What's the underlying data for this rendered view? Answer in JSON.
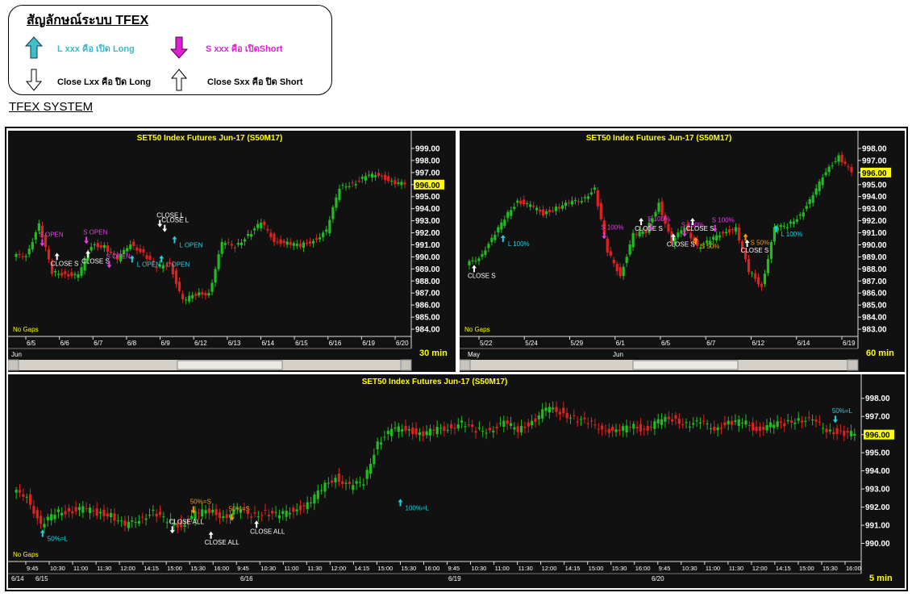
{
  "legend": {
    "title": "สัญลักษณ์ระบบ TFEX",
    "open_long": {
      "label": "L xxx คือ เปิด Long",
      "color": "#3fb7c4"
    },
    "open_short": {
      "label": "S xxx คือ เปิดShort",
      "color": "#e020d0"
    },
    "close_long": {
      "label": "Close Lxx คือ ปิด Long"
    },
    "close_short": {
      "label": "Close Sxx คือ ปิด Short"
    }
  },
  "system_title": "TFEX SYSTEM",
  "colors": {
    "background": "#111111",
    "up": "#22bb22",
    "down": "#dd2222",
    "title": "#ffff00",
    "axis_text": "#ffffff",
    "long": "#22d0e0",
    "short": "#e040e0",
    "close": "#ffffff",
    "half": "#ff9900",
    "price_box": "#ffff00"
  },
  "chart_data": [
    {
      "type": "line",
      "title": "SET50  Index  Futures  Jun-17  (S50M17)",
      "timeframe": "30  min",
      "no_gaps": "No Gaps",
      "yticks": [
        "999.00",
        "998.00",
        "997.00",
        "996.00",
        "995.00",
        "994.00",
        "993.00",
        "992.00",
        "991.00",
        "990.00",
        "989.00",
        "988.00",
        "987.00",
        "986.00",
        "985.00",
        "984.00"
      ],
      "ylim": [
        983.4,
        999.4
      ],
      "current_price": "996.00",
      "current_value": 996.0,
      "xticks": [
        "6/5",
        "6/6",
        "6/7",
        "6/8",
        "6/9",
        "6/12",
        "6/13",
        "6/14",
        "6/15",
        "6/16",
        "6/19",
        "6/20"
      ],
      "month_label": "Jun",
      "x": [
        0,
        4,
        8,
        12,
        16,
        20,
        24,
        28,
        32,
        36,
        40,
        44,
        48,
        52,
        56,
        60,
        64,
        68,
        72,
        76,
        80,
        84,
        88,
        92,
        96,
        100,
        104,
        108,
        112,
        116,
        120
      ],
      "series": [
        {
          "values": [
            990.0,
            990.2,
            992.6,
            988.7,
            988.6,
            988.4,
            991.0,
            990.9,
            989.7,
            991.2,
            990.2,
            989.1,
            989.5,
            986.3,
            986.9,
            987.0,
            991.1,
            990.9,
            991.8,
            992.8,
            991.4,
            991.1,
            990.9,
            991.4,
            992.1,
            995.8,
            996.1,
            996.6,
            996.9,
            996.2,
            996.0
          ]
        }
      ],
      "annotations": [
        {
          "text": "S  OPEN",
          "x": 8.5,
          "y": 991.4,
          "kind": "short",
          "dir": "down"
        },
        {
          "text": "CLOSE  S",
          "x": 13,
          "y": 989.8,
          "kind": "close",
          "dir": "up"
        },
        {
          "text": "S  OPEN",
          "x": 22,
          "y": 991.6,
          "kind": "short",
          "dir": "down"
        },
        {
          "text": "CLOSE  S",
          "x": 22.5,
          "y": 990.0,
          "kind": "close",
          "dir": "up"
        },
        {
          "text": "S  OPEN",
          "x": 29,
          "y": 989.6,
          "kind": "short",
          "dir": "down"
        },
        {
          "text": "L  OPEN",
          "x": 36,
          "y": 989.6,
          "kind": "long",
          "dir": "up"
        },
        {
          "text": "L  OPEN",
          "x": 45,
          "y": 989.6,
          "kind": "long",
          "dir": "up"
        },
        {
          "text": "CLOSE  L",
          "x": 44.5,
          "y": 993.0,
          "kind": "close",
          "dir": "down"
        },
        {
          "text": "CLOSE  L",
          "x": 46,
          "y": 992.6,
          "kind": "close",
          "dir": "down"
        },
        {
          "text": "L  OPEN",
          "x": 49,
          "y": 991.2,
          "kind": "long",
          "dir": "up"
        }
      ]
    },
    {
      "type": "line",
      "title": "SET50  Index  Futures  Jun-17  (S50M17)",
      "timeframe": "60  min",
      "no_gaps": "No Gaps",
      "yticks": [
        "998.00",
        "997.00",
        "996.00",
        "995.00",
        "994.00",
        "993.00",
        "992.00",
        "991.00",
        "990.00",
        "989.00",
        "988.00",
        "987.00",
        "986.00",
        "985.00",
        "984.00",
        "983.00"
      ],
      "ylim": [
        982.4,
        998.4
      ],
      "current_price": "996.00",
      "current_value": 996.0,
      "xticks": [
        "5/22",
        "5/24",
        "5/29",
        "6/1",
        "6/5",
        "6/7",
        "6/12",
        "6/14",
        "6/19"
      ],
      "month_label_1": "May",
      "month_label_2": "Jun",
      "x": [
        0,
        4,
        8,
        12,
        16,
        20,
        24,
        28,
        32,
        36,
        40,
        44,
        48,
        52,
        56,
        60,
        64,
        68,
        72,
        76,
        80,
        84,
        88,
        92,
        96,
        100,
        104,
        108,
        112,
        116,
        120
      ],
      "series": [
        {
          "values": [
            988.3,
            989.0,
            990.4,
            992.2,
            993.7,
            993.2,
            992.6,
            993.1,
            993.4,
            993.8,
            994.6,
            989.4,
            987.5,
            990.8,
            991.1,
            993.5,
            990.1,
            991.6,
            989.8,
            990.3,
            991.1,
            991.3,
            987.8,
            986.6,
            991.3,
            991.6,
            992.5,
            994.0,
            996.2,
            997.3,
            996.0
          ]
        }
      ],
      "annotations": [
        {
          "text": "CLOSE  S",
          "x": 2,
          "y": 987.8,
          "kind": "close",
          "dir": "up"
        },
        {
          "text": "L  100%",
          "x": 11,
          "y": 990.3,
          "kind": "long",
          "dir": "up"
        },
        {
          "text": "S  100%",
          "x": 42.5,
          "y": 991.0,
          "kind": "short",
          "dir": "down"
        },
        {
          "text": "CLOSE  S",
          "x": 54,
          "y": 991.7,
          "kind": "close",
          "dir": "up"
        },
        {
          "text": "S  100%",
          "x": 57,
          "y": 991.7,
          "kind": "short",
          "dir": "down"
        },
        {
          "text": "CLOSE  S",
          "x": 64,
          "y": 990.4,
          "kind": "close",
          "dir": "up"
        },
        {
          "text": "S  100%",
          "x": 67.5,
          "y": 991.2,
          "kind": "short",
          "dir": "down"
        },
        {
          "text": "S  100%",
          "x": 77,
          "y": 991.6,
          "kind": "short",
          "dir": "down"
        },
        {
          "text": "CLOSE  S",
          "x": 70,
          "y": 991.7,
          "kind": "close",
          "dir": "up"
        },
        {
          "text": "S  50%",
          "x": 71,
          "y": 990.1,
          "kind": "half",
          "dir": "up"
        },
        {
          "text": "S  50%",
          "x": 86.5,
          "y": 990.4,
          "kind": "half",
          "dir": "up"
        },
        {
          "text": "CLOSE  S",
          "x": 87,
          "y": 989.9,
          "kind": "close",
          "dir": "up"
        },
        {
          "text": "L  100%",
          "x": 96,
          "y": 991.1,
          "kind": "long",
          "dir": "up"
        }
      ]
    },
    {
      "type": "line",
      "title": "SET50  Index  Futures  Jun-17  (S50M17)",
      "timeframe": "5  min",
      "no_gaps": "No Gaps",
      "yticks": [
        "998.00",
        "997.00",
        "996.00",
        "995.00",
        "994.00",
        "993.00",
        "992.00",
        "991.00",
        "990.00"
      ],
      "ylim": [
        989.0,
        998.7
      ],
      "current_price": "996.00",
      "current_value": 996.0,
      "xticks": [
        "9:45",
        "10:30",
        "11:00",
        "11:30",
        "12:00",
        "14:15",
        "15:00",
        "15:30",
        "16:00",
        "9:45",
        "10:30",
        "11:00",
        "11:30",
        "12:00",
        "14:15",
        "15:00",
        "15:30",
        "16:00",
        "9:45",
        "10:30",
        "11:00",
        "11:30",
        "12:00",
        "14:15",
        "15:00",
        "15:30",
        "16:00",
        "9:45",
        "10:30",
        "11:00",
        "11:30",
        "12:00",
        "14:15",
        "15:00",
        "15:30",
        "16:00"
      ],
      "day_labels": [
        "6/14",
        "6/15",
        "6/16",
        "6/19",
        "6/20"
      ],
      "x": [
        0,
        4,
        8,
        12,
        16,
        20,
        24,
        28,
        32,
        36,
        40,
        44,
        48,
        52,
        56,
        60,
        64,
        68,
        72,
        76,
        80,
        84,
        88,
        92,
        96,
        100,
        104,
        108,
        112,
        116,
        120,
        124,
        128,
        132,
        136,
        140,
        144,
        148,
        152,
        156,
        160,
        164,
        168,
        172,
        176,
        180,
        184,
        188,
        192,
        196,
        200,
        204,
        208,
        212,
        216,
        220,
        224,
        228,
        232,
        236,
        240
      ],
      "series": [
        {
          "values": [
            992.8,
            992.7,
            990.9,
            991.7,
            991.8,
            991.9,
            991.7,
            991.6,
            990.9,
            991.4,
            991.7,
            991.2,
            991.0,
            991.6,
            991.8,
            991.5,
            991.8,
            991.6,
            991.7,
            991.5,
            991.9,
            992.1,
            993.0,
            993.7,
            993.1,
            993.4,
            995.6,
            996.2,
            996.4,
            996.0,
            996.2,
            996.4,
            996.6,
            996.2,
            996.3,
            996.6,
            996.3,
            996.7,
            997.4,
            997.3,
            996.9,
            996.6,
            996.4,
            996.1,
            996.5,
            996.3,
            996.7,
            996.9,
            996.6,
            996.6,
            996.4,
            996.6,
            996.7,
            996.3,
            996.5,
            996.6,
            996.9,
            996.7,
            996.3,
            996.1,
            996.0
          ]
        }
      ],
      "annotations": [
        {
          "text": "50%=L",
          "x": 8,
          "y": 990.4,
          "kind": "long",
          "dir": "up"
        },
        {
          "text": "CLOSE  ALL",
          "x": 45,
          "y": 990.9,
          "kind": "close",
          "dir": "down"
        },
        {
          "text": "50%=S",
          "x": 51,
          "y": 992.0,
          "kind": "half",
          "dir": "down"
        },
        {
          "text": "CLOSE  ALL",
          "x": 56,
          "y": 990.3,
          "kind": "close",
          "dir": "up"
        },
        {
          "text": "50%=S",
          "x": 62,
          "y": 991.6,
          "kind": "half",
          "dir": "down"
        },
        {
          "text": "CLOSE  ALL",
          "x": 69,
          "y": 990.9,
          "kind": "close",
          "dir": "up"
        },
        {
          "text": "100%=L",
          "x": 110,
          "y": 992.1,
          "kind": "long",
          "dir": "up"
        },
        {
          "text": "50%=L",
          "x": 234,
          "y": 997.0,
          "kind": "long",
          "dir": "down"
        }
      ]
    }
  ]
}
